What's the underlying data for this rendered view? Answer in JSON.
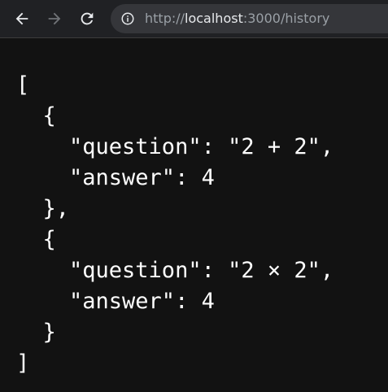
{
  "browser": {
    "url_prefix": "http://",
    "url_host": "localhost",
    "url_rest": ":3000/history",
    "icons": {
      "back": "arrow-left-icon",
      "forward": "arrow-right-icon",
      "reload": "reload-icon",
      "site_info": "info-circle-icon"
    }
  },
  "json_lines": [
    "[",
    "  {",
    "    \"question\": \"2 + 2\",",
    "    \"answer\": 4",
    "  },",
    "  {",
    "    \"question\": \"2 × 2\",",
    "    \"answer\": 4",
    "  }",
    "]"
  ]
}
